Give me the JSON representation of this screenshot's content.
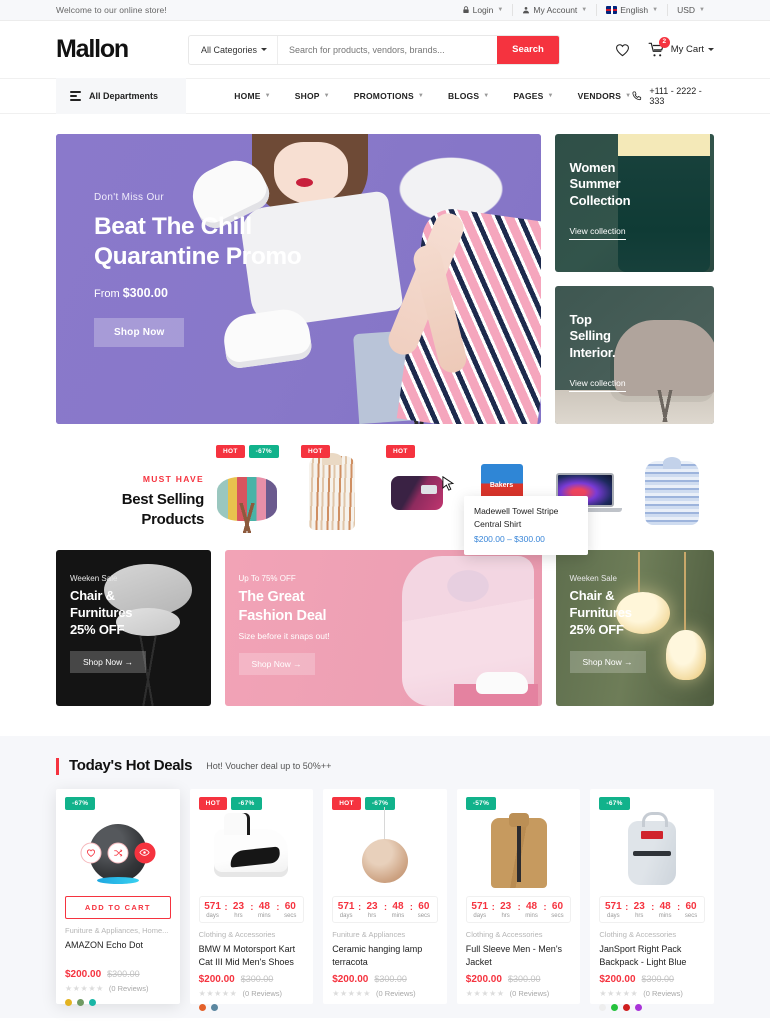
{
  "topbar": {
    "welcome": "Welcome to our online store!",
    "items": [
      {
        "label": "Login",
        "icon": "lock-icon"
      },
      {
        "label": "My Account",
        "icon": "user-icon"
      },
      {
        "label": "English",
        "icon": "flag-icon"
      },
      {
        "label": "USD",
        "icon": ""
      }
    ]
  },
  "header": {
    "logo": "Mallon",
    "category_select": "All Categories",
    "search_placeholder": "Search for products, vendors, brands...",
    "search_value": "",
    "search_button": "Search",
    "cart_label": "My Cart",
    "cart_count": "2"
  },
  "nav": {
    "departments": "All Departments",
    "links": [
      {
        "label": "HOME"
      },
      {
        "label": "SHOP"
      },
      {
        "label": "PROMOTIONS"
      },
      {
        "label": "BLOGS"
      },
      {
        "label": "PAGES"
      },
      {
        "label": "VENDORS"
      }
    ],
    "phone": "+111 - 2222 - 333"
  },
  "hero": {
    "kicker": "Don't Miss Our",
    "title": "Beat The Chill\nQuarantine Promo",
    "from_label": "From ",
    "from_price": "$300.00",
    "button": "Shop Now",
    "side_cards": [
      {
        "title": "Women\nSummer\nCollection",
        "link": "View collection"
      },
      {
        "title": "Top\nSelling\nInterior.",
        "link": "View collection"
      }
    ]
  },
  "best_selling": {
    "kicker": "MUST HAVE",
    "title": "Best Selling\nProducts",
    "items": [
      {
        "name": "Patchwork Stool",
        "tags": [
          "HOT",
          "-67%"
        ]
      },
      {
        "name": "Madewell Towel Stripe Central Shirt",
        "tags": [
          "HOT"
        ]
      },
      {
        "name": "Sport Bag",
        "tags": [
          "HOT"
        ]
      },
      {
        "name": "Bakers Dog Food",
        "tags": []
      },
      {
        "name": "MacBook Pro",
        "tags": []
      },
      {
        "name": "Striped Blouse",
        "tags": []
      }
    ],
    "quickview": {
      "name": "Madewell Towel Stripe Central Shirt",
      "price": "$200.00 – $300.00"
    }
  },
  "banners": [
    {
      "kicker": "Weeken Sale",
      "title": "Chair &\nFurnitures\n25% OFF",
      "sub": "",
      "button": "Shop Now  →"
    },
    {
      "kicker": "Up To 75% OFF",
      "title": "The Great\nFashion Deal",
      "sub": "Size before it snaps out!",
      "button": "Shop Now  →"
    },
    {
      "kicker": "Weeken Sale",
      "title": "Chair &\nFurnitures\n25% OFF",
      "sub": "",
      "button": "Shop Now  →"
    }
  ],
  "deals": {
    "title": "Today's Hot Deals",
    "subtitle": "Hot! Voucher deal up to 50%++",
    "add_to_cart": "ADD TO CART",
    "countdown_labels": [
      "days",
      "hrs",
      "mins",
      "secs"
    ],
    "products": [
      {
        "tags": [
          {
            "text": "-67%",
            "type": "off"
          }
        ],
        "category": "Funiture & Appliances, Home...",
        "name": "AMAZON Echo Dot",
        "price_new": "$200.00",
        "price_old": "$300.00",
        "stars": "★★★★★",
        "reviews": "(0 Reviews)",
        "swatches": [
          "#e3b321",
          "#6f9a62",
          "#19b6a6"
        ],
        "countdown": null,
        "hovered": true
      },
      {
        "tags": [
          {
            "text": "HOT",
            "type": "hot"
          },
          {
            "text": "-67%",
            "type": "off"
          }
        ],
        "category": "Clothing & Accessories",
        "name": "BMW M Motorsport Kart Cat III Mid Men's Shoes",
        "price_new": "$200.00",
        "price_old": "$300.00",
        "stars": "★★★★★",
        "reviews": "(0 Reviews)",
        "swatches": [
          "#e4612a",
          "#5b87a0"
        ],
        "countdown": [
          "571",
          "23",
          "48",
          "60"
        ],
        "hovered": false
      },
      {
        "tags": [
          {
            "text": "HOT",
            "type": "hot"
          },
          {
            "text": "-67%",
            "type": "off"
          }
        ],
        "category": "Funiture & Appliances",
        "name": "Ceramic hanging lamp terracota",
        "price_new": "$200.00",
        "price_old": "$300.00",
        "stars": "★★★★★",
        "reviews": "(0 Reviews)",
        "swatches": [],
        "countdown": [
          "571",
          "23",
          "48",
          "60"
        ],
        "hovered": false
      },
      {
        "tags": [
          {
            "text": "-57%",
            "type": "off"
          }
        ],
        "category": "Clothing & Accessories",
        "name": "Full Sleeve Men - Men's Jacket",
        "price_new": "$200.00",
        "price_old": "$300.00",
        "stars": "★★★★★",
        "reviews": "(0 Reviews)",
        "swatches": [],
        "countdown": [
          "571",
          "23",
          "48",
          "60"
        ],
        "hovered": false
      },
      {
        "tags": [
          {
            "text": "-67%",
            "type": "off"
          }
        ],
        "category": "Clothing & Accessories",
        "name": "JanSport Right Pack Backpack - Light Blue",
        "price_new": "$200.00",
        "price_old": "$300.00",
        "stars": "★★★★★",
        "reviews": "(0 Reviews)",
        "swatches": [
          "#eeeeee",
          "#25c23d",
          "#cf1f1f",
          "#a934d8"
        ],
        "countdown": [
          "571",
          "23",
          "48",
          "60"
        ],
        "hovered": false
      }
    ]
  },
  "colors": {
    "accent": "#f5333f",
    "teal": "#11b28b",
    "link": "#3a86d8"
  }
}
